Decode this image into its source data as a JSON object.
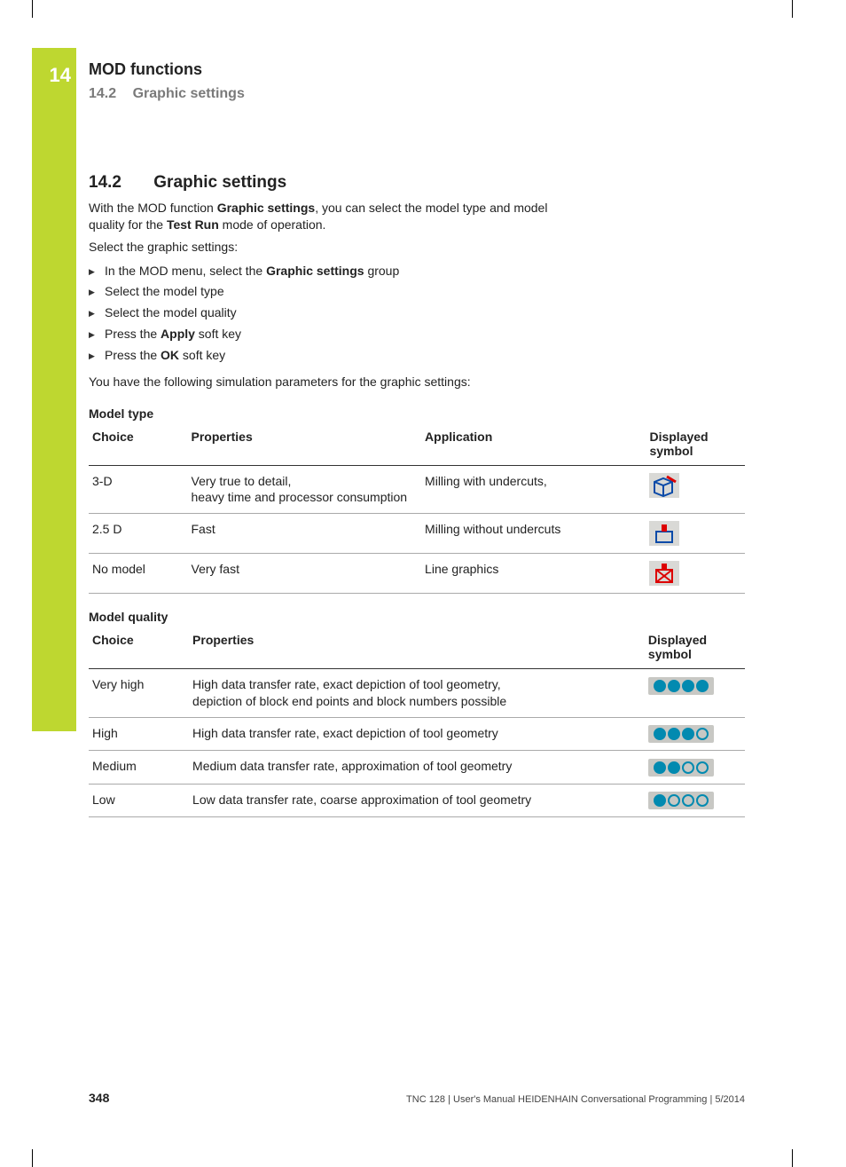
{
  "sidebar": {
    "chapter_num": "14"
  },
  "header": {
    "chapter_title": "MOD functions",
    "section_number": "14.2",
    "section_title": "Graphic settings"
  },
  "heading": {
    "number": "14.2",
    "title": "Graphic settings"
  },
  "intro": {
    "p1_a": "With the MOD function ",
    "p1_b": "Graphic settings",
    "p1_c": ", you can select the model type and model quality for the ",
    "p1_d": "Test Run",
    "p1_e": " mode of operation.",
    "p2": "Select the graphic settings:"
  },
  "steps": {
    "s1_a": "In the MOD menu, select the ",
    "s1_b": "Graphic settings",
    "s1_c": " group",
    "s2": "Select the model type",
    "s3": "Select the model quality",
    "s4_a": "Press the ",
    "s4_b": "Apply",
    "s4_c": " soft key",
    "s5_a": "Press the ",
    "s5_b": "OK",
    "s5_c": " soft key"
  },
  "post_steps": "You have the following simulation parameters for the graphic settings:",
  "table1": {
    "title": "Model type",
    "headers": {
      "choice": "Choice",
      "properties": "Properties",
      "application": "Application",
      "symbol": "Displayed symbol"
    },
    "rows": [
      {
        "choice": "3-D",
        "prop1": "Very true to detail,",
        "prop2": "heavy time and processor consumption",
        "app": "Milling with undercuts,"
      },
      {
        "choice": "2.5 D",
        "prop1": "Fast",
        "prop2": "",
        "app": "Milling without undercuts"
      },
      {
        "choice": "No model",
        "prop1": "Very fast",
        "prop2": "",
        "app": "Line graphics"
      }
    ]
  },
  "table2": {
    "title": "Model quality",
    "headers": {
      "choice": "Choice",
      "properties": "Properties",
      "symbol": "Displayed symbol"
    },
    "rows": [
      {
        "choice": "Very high",
        "prop1": "High data transfer rate, exact depiction of tool geometry,",
        "prop2": "depiction of block end points and block numbers possible",
        "dots": 4
      },
      {
        "choice": "High",
        "prop1": "High data transfer rate, exact depiction of tool geometry",
        "prop2": "",
        "dots": 3
      },
      {
        "choice": "Medium",
        "prop1": "Medium data transfer rate, approximation of tool geometry",
        "prop2": "",
        "dots": 2
      },
      {
        "choice": "Low",
        "prop1": "Low data transfer rate, coarse approximation of tool geometry",
        "prop2": "",
        "dots": 1
      }
    ]
  },
  "footer": {
    "page": "348",
    "text": "TNC 128 | User's Manual HEIDENHAIN Conversational Programming | 5/2014"
  }
}
